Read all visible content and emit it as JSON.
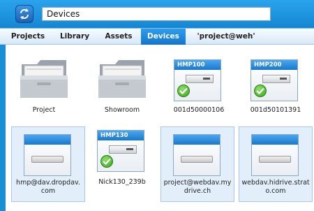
{
  "window": {
    "title": "Devices"
  },
  "tabs": [
    {
      "label": "Projects"
    },
    {
      "label": "Library"
    },
    {
      "label": "Assets"
    },
    {
      "label": "Devices",
      "active": true
    },
    {
      "label": "'project@weh'"
    }
  ],
  "items": [
    {
      "type": "folder",
      "label": "Project"
    },
    {
      "type": "folder",
      "label": "Showroom"
    },
    {
      "type": "device",
      "badge": "HMP100",
      "label": "001d50000106",
      "status": "ok"
    },
    {
      "type": "device",
      "badge": "HMP200",
      "label": "001d50101391",
      "status": "ok"
    },
    {
      "type": "drive",
      "label_line1": "hmp@dav.dropdav.",
      "label_line2": "com"
    },
    {
      "type": "device",
      "badge": "HMP130",
      "label": "Nick130_239b",
      "status": "ok"
    },
    {
      "type": "drive",
      "label_line1": "project@webdav.my",
      "label_line2": "drive.ch"
    },
    {
      "type": "drive",
      "label_line1": "webdav.hidrive.strat",
      "label_line2": "o.com"
    }
  ],
  "colors": {
    "accent": "#1a8fd6",
    "header_blue": "#2d9df0",
    "check_green": "#4fbf2a"
  }
}
